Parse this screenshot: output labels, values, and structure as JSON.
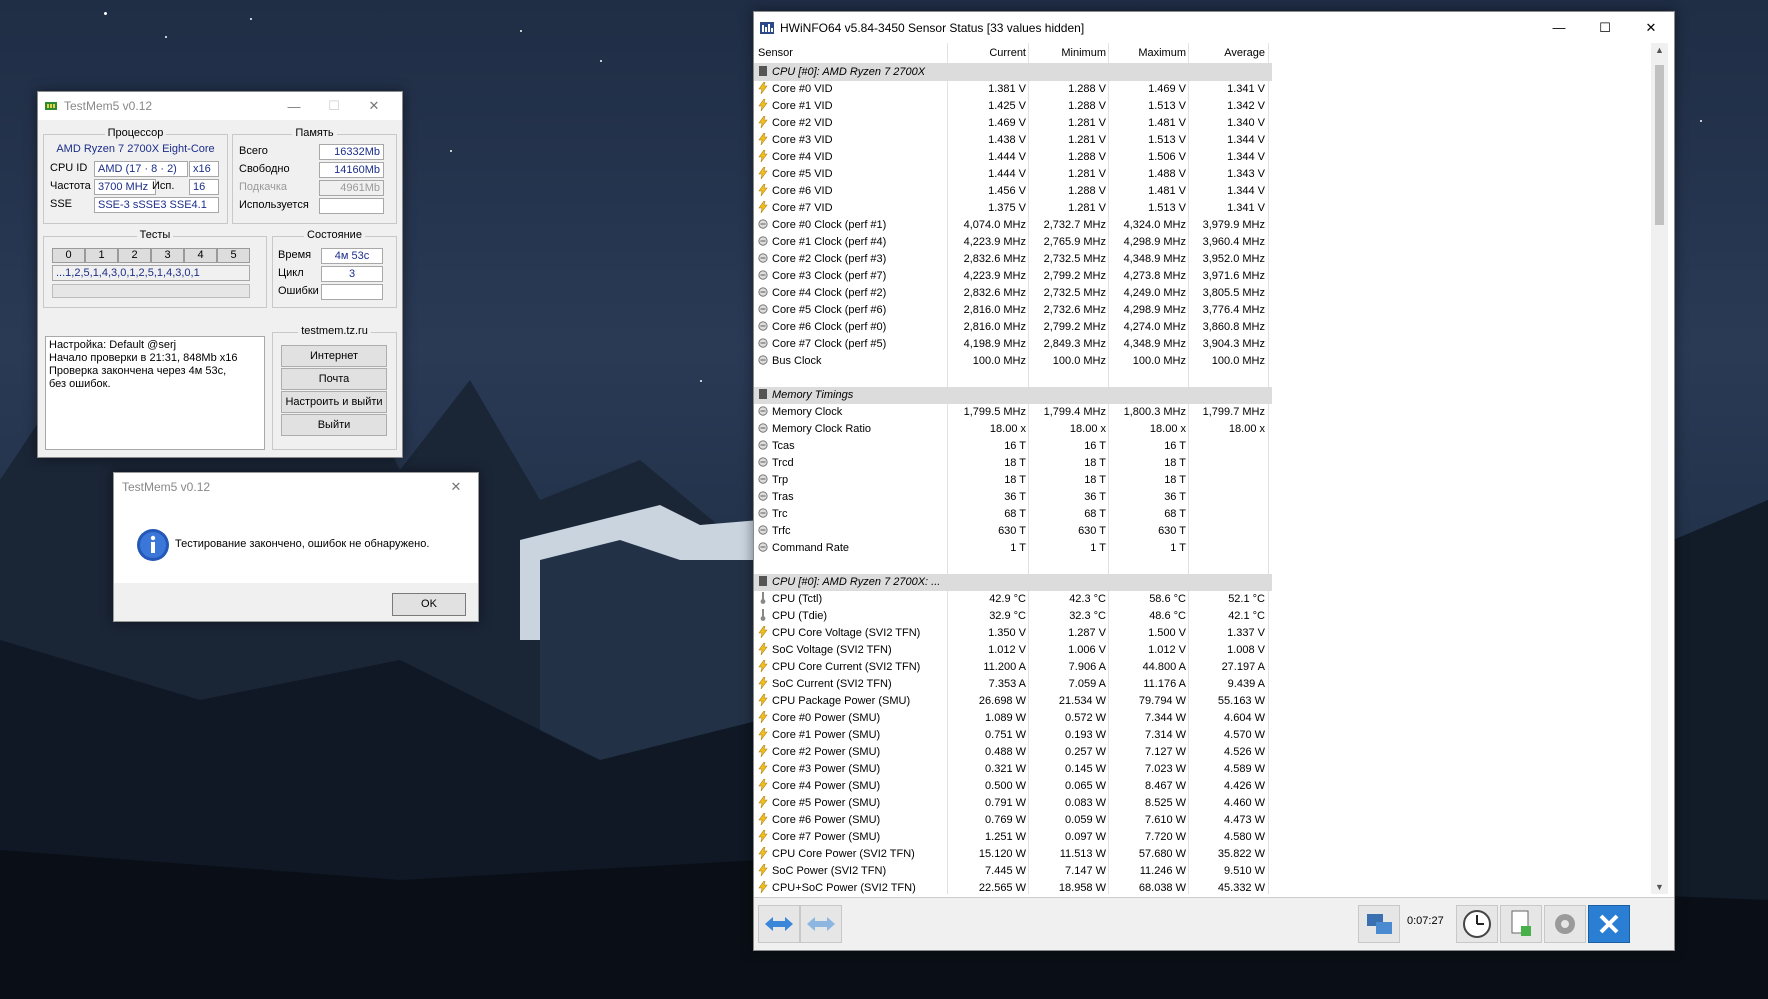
{
  "testmem": {
    "title": "TestMem5 v0.12",
    "processor_caption": "Процессор",
    "cpu_name": "AMD Ryzen 7 2700X Eight-Core",
    "cpu_id_label": "CPU ID",
    "cpu_id_value": "AMD  (17 · 8 · 2)",
    "cpu_id_x": "x16",
    "freq_label": "Частота",
    "freq_value": "3700 MHz",
    "used_label": "Исп.",
    "used_value": "16",
    "sse_label": "SSE",
    "sse_value": "SSE-3 sSSE3 SSE4.1",
    "memory_caption": "Память",
    "total_label": "Всего",
    "total_value": "16332Mb",
    "free_label": "Свободно",
    "free_value": "14160Mb",
    "swap_label": "Подкачка",
    "swap_value": "4961Mb",
    "used_mem_label": "Используется",
    "used_mem_value": "",
    "tests_caption": "Тесты",
    "test_cells": [
      "0",
      "1",
      "2",
      "3",
      "4",
      "5"
    ],
    "test_sequence": "...1,2,5,1,4,3,0,1,2,5,1,4,3,0,1",
    "state_caption": "Состояние",
    "time_label": "Время",
    "time_value": "4м 53с",
    "cycle_label": "Цикл",
    "cycle_value": "3",
    "errors_label": "Ошибки",
    "errors_value": "",
    "log": [
      "Настройка: Default @serj",
      "Начало проверки в 21:31, 848Mb x16",
      "Проверка закончена через 4м 53с,",
      "без ошибок."
    ],
    "site_caption": "testmem.tz.ru",
    "btn_internet": "Интернет",
    "btn_mail": "Почта",
    "btn_configure": "Настроить и выйти",
    "btn_exit": "Выйти"
  },
  "dialog": {
    "title": "TestMem5 v0.12",
    "message": "Тестирование закончено, ошибок не обнаружено.",
    "ok": "OK"
  },
  "hwinfo": {
    "title": "HWiNFO64 v5.84-3450 Sensor Status [33 values hidden]",
    "columns": [
      "Sensor",
      "Current",
      "Minimum",
      "Maximum",
      "Average"
    ],
    "elapsed": "0:07:27",
    "rows": [
      {
        "type": "group",
        "name": "CPU [#0]: AMD Ryzen 7 2700X"
      },
      {
        "type": "row",
        "icon": "bolt",
        "name": "Core #0 VID",
        "cur": "1.381 V",
        "min": "1.288 V",
        "max": "1.469 V",
        "avg": "1.341 V"
      },
      {
        "type": "row",
        "icon": "bolt",
        "name": "Core #1 VID",
        "cur": "1.425 V",
        "min": "1.288 V",
        "max": "1.513 V",
        "avg": "1.342 V"
      },
      {
        "type": "row",
        "icon": "bolt",
        "name": "Core #2 VID",
        "cur": "1.469 V",
        "min": "1.281 V",
        "max": "1.481 V",
        "avg": "1.340 V"
      },
      {
        "type": "row",
        "icon": "bolt",
        "name": "Core #3 VID",
        "cur": "1.438 V",
        "min": "1.281 V",
        "max": "1.513 V",
        "avg": "1.344 V"
      },
      {
        "type": "row",
        "icon": "bolt",
        "name": "Core #4 VID",
        "cur": "1.444 V",
        "min": "1.288 V",
        "max": "1.506 V",
        "avg": "1.344 V"
      },
      {
        "type": "row",
        "icon": "bolt",
        "name": "Core #5 VID",
        "cur": "1.444 V",
        "min": "1.281 V",
        "max": "1.488 V",
        "avg": "1.343 V"
      },
      {
        "type": "row",
        "icon": "bolt",
        "name": "Core #6 VID",
        "cur": "1.456 V",
        "min": "1.288 V",
        "max": "1.481 V",
        "avg": "1.344 V"
      },
      {
        "type": "row",
        "icon": "bolt",
        "name": "Core #7 VID",
        "cur": "1.375 V",
        "min": "1.281 V",
        "max": "1.513 V",
        "avg": "1.341 V"
      },
      {
        "type": "row",
        "icon": "clock",
        "name": "Core #0 Clock (perf #1)",
        "cur": "4,074.0 MHz",
        "min": "2,732.7 MHz",
        "max": "4,324.0 MHz",
        "avg": "3,979.9 MHz"
      },
      {
        "type": "row",
        "icon": "clock",
        "name": "Core #1 Clock (perf #4)",
        "cur": "4,223.9 MHz",
        "min": "2,765.9 MHz",
        "max": "4,298.9 MHz",
        "avg": "3,960.4 MHz"
      },
      {
        "type": "row",
        "icon": "clock",
        "name": "Core #2 Clock (perf #3)",
        "cur": "2,832.6 MHz",
        "min": "2,732.5 MHz",
        "max": "4,348.9 MHz",
        "avg": "3,952.0 MHz"
      },
      {
        "type": "row",
        "icon": "clock",
        "name": "Core #3 Clock (perf #7)",
        "cur": "4,223.9 MHz",
        "min": "2,799.2 MHz",
        "max": "4,273.8 MHz",
        "avg": "3,971.6 MHz"
      },
      {
        "type": "row",
        "icon": "clock",
        "name": "Core #4 Clock (perf #2)",
        "cur": "2,832.6 MHz",
        "min": "2,732.5 MHz",
        "max": "4,249.0 MHz",
        "avg": "3,805.5 MHz"
      },
      {
        "type": "row",
        "icon": "clock",
        "name": "Core #5 Clock (perf #6)",
        "cur": "2,816.0 MHz",
        "min": "2,732.6 MHz",
        "max": "4,298.9 MHz",
        "avg": "3,776.4 MHz"
      },
      {
        "type": "row",
        "icon": "clock",
        "name": "Core #6 Clock (perf #0)",
        "cur": "2,816.0 MHz",
        "min": "2,799.2 MHz",
        "max": "4,274.0 MHz",
        "avg": "3,860.8 MHz"
      },
      {
        "type": "row",
        "icon": "clock",
        "name": "Core #7 Clock (perf #5)",
        "cur": "4,198.9 MHz",
        "min": "2,849.3 MHz",
        "max": "4,348.9 MHz",
        "avg": "3,904.3 MHz"
      },
      {
        "type": "row",
        "icon": "clock",
        "name": "Bus Clock",
        "cur": "100.0 MHz",
        "min": "100.0 MHz",
        "max": "100.0 MHz",
        "avg": "100.0 MHz"
      },
      {
        "type": "blank"
      },
      {
        "type": "group",
        "name": "Memory Timings"
      },
      {
        "type": "row",
        "icon": "clock",
        "name": "Memory Clock",
        "cur": "1,799.5 MHz",
        "min": "1,799.4 MHz",
        "max": "1,800.3 MHz",
        "avg": "1,799.7 MHz"
      },
      {
        "type": "row",
        "icon": "clock",
        "name": "Memory Clock Ratio",
        "cur": "18.00 x",
        "min": "18.00 x",
        "max": "18.00 x",
        "avg": "18.00 x"
      },
      {
        "type": "row",
        "icon": "clock",
        "name": "Tcas",
        "cur": "16 T",
        "min": "16 T",
        "max": "16 T",
        "avg": ""
      },
      {
        "type": "row",
        "icon": "clock",
        "name": "Trcd",
        "cur": "18 T",
        "min": "18 T",
        "max": "18 T",
        "avg": ""
      },
      {
        "type": "row",
        "icon": "clock",
        "name": "Trp",
        "cur": "18 T",
        "min": "18 T",
        "max": "18 T",
        "avg": ""
      },
      {
        "type": "row",
        "icon": "clock",
        "name": "Tras",
        "cur": "36 T",
        "min": "36 T",
        "max": "36 T",
        "avg": ""
      },
      {
        "type": "row",
        "icon": "clock",
        "name": "Trc",
        "cur": "68 T",
        "min": "68 T",
        "max": "68 T",
        "avg": ""
      },
      {
        "type": "row",
        "icon": "clock",
        "name": "Trfc",
        "cur": "630 T",
        "min": "630 T",
        "max": "630 T",
        "avg": ""
      },
      {
        "type": "row",
        "icon": "clock",
        "name": "Command Rate",
        "cur": "1 T",
        "min": "1 T",
        "max": "1 T",
        "avg": ""
      },
      {
        "type": "blank"
      },
      {
        "type": "group",
        "name": "CPU [#0]: AMD Ryzen 7 2700X: ..."
      },
      {
        "type": "row",
        "icon": "thermo",
        "name": "CPU (Tctl)",
        "cur": "42.9 °C",
        "min": "42.3 °C",
        "max": "58.6 °C",
        "avg": "52.1 °C"
      },
      {
        "type": "row",
        "icon": "thermo",
        "name": "CPU (Tdie)",
        "cur": "32.9 °C",
        "min": "32.3 °C",
        "max": "48.6 °C",
        "avg": "42.1 °C"
      },
      {
        "type": "row",
        "icon": "bolt",
        "name": "CPU Core Voltage (SVI2 TFN)",
        "cur": "1.350 V",
        "min": "1.287 V",
        "max": "1.500 V",
        "avg": "1.337 V"
      },
      {
        "type": "row",
        "icon": "bolt",
        "name": "SoC Voltage (SVI2 TFN)",
        "cur": "1.012 V",
        "min": "1.006 V",
        "max": "1.012 V",
        "avg": "1.008 V"
      },
      {
        "type": "row",
        "icon": "bolt",
        "name": "CPU Core Current (SVI2 TFN)",
        "cur": "11.200 A",
        "min": "7.906 A",
        "max": "44.800 A",
        "avg": "27.197 A"
      },
      {
        "type": "row",
        "icon": "bolt",
        "name": "SoC Current (SVI2 TFN)",
        "cur": "7.353 A",
        "min": "7.059 A",
        "max": "11.176 A",
        "avg": "9.439 A"
      },
      {
        "type": "row",
        "icon": "bolt",
        "name": "CPU Package Power (SMU)",
        "cur": "26.698 W",
        "min": "21.534 W",
        "max": "79.794 W",
        "avg": "55.163 W"
      },
      {
        "type": "row",
        "icon": "bolt",
        "name": "Core #0 Power (SMU)",
        "cur": "1.089 W",
        "min": "0.572 W",
        "max": "7.344 W",
        "avg": "4.604 W"
      },
      {
        "type": "row",
        "icon": "bolt",
        "name": "Core #1 Power (SMU)",
        "cur": "0.751 W",
        "min": "0.193 W",
        "max": "7.314 W",
        "avg": "4.570 W"
      },
      {
        "type": "row",
        "icon": "bolt",
        "name": "Core #2 Power (SMU)",
        "cur": "0.488 W",
        "min": "0.257 W",
        "max": "7.127 W",
        "avg": "4.526 W"
      },
      {
        "type": "row",
        "icon": "bolt",
        "name": "Core #3 Power (SMU)",
        "cur": "0.321 W",
        "min": "0.145 W",
        "max": "7.023 W",
        "avg": "4.589 W"
      },
      {
        "type": "row",
        "icon": "bolt",
        "name": "Core #4 Power (SMU)",
        "cur": "0.500 W",
        "min": "0.065 W",
        "max": "8.467 W",
        "avg": "4.426 W"
      },
      {
        "type": "row",
        "icon": "bolt",
        "name": "Core #5 Power (SMU)",
        "cur": "0.791 W",
        "min": "0.083 W",
        "max": "8.525 W",
        "avg": "4.460 W"
      },
      {
        "type": "row",
        "icon": "bolt",
        "name": "Core #6 Power (SMU)",
        "cur": "0.769 W",
        "min": "0.059 W",
        "max": "7.610 W",
        "avg": "4.473 W"
      },
      {
        "type": "row",
        "icon": "bolt",
        "name": "Core #7 Power (SMU)",
        "cur": "1.251 W",
        "min": "0.097 W",
        "max": "7.720 W",
        "avg": "4.580 W"
      },
      {
        "type": "row",
        "icon": "bolt",
        "name": "CPU Core Power (SVI2 TFN)",
        "cur": "15.120 W",
        "min": "11.513 W",
        "max": "57.680 W",
        "avg": "35.822 W"
      },
      {
        "type": "row",
        "icon": "bolt",
        "name": "SoC Power (SVI2 TFN)",
        "cur": "7.445 W",
        "min": "7.147 W",
        "max": "11.246 W",
        "avg": "9.510 W"
      },
      {
        "type": "row",
        "icon": "bolt",
        "name": "CPU+SoC Power (SVI2 TFN)",
        "cur": "22.565 W",
        "min": "18.958 W",
        "max": "68.038 W",
        "avg": "45.332 W"
      }
    ]
  }
}
